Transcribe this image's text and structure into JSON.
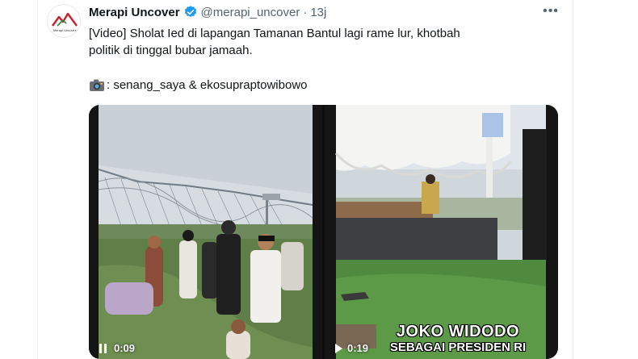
{
  "author": {
    "display_name": "Merapi Uncover",
    "handle": "@merapi_uncover",
    "separator": "·",
    "time": "13j",
    "avatar_caption": "Merapi Uncover"
  },
  "tweet": {
    "text": "[Video] Sholat Ied di lapangan Tamanan Bantul lagi rame lur,  khotbah politik di tinggal bubar jamaah.",
    "credit": ": senang_saya & ekosupraptowibowo",
    "more_label": "•••"
  },
  "media": {
    "videos": [
      {
        "timestamp": "0:09",
        "state": "paused"
      },
      {
        "timestamp": "0:19",
        "state": "playing",
        "caption_line1": "JOKO WIDODO",
        "caption_line2": "SEBAGAI PRESIDEN RI"
      }
    ]
  },
  "colors": {
    "text": "#0f1419",
    "secondary": "#536471",
    "verified": "#1d9bf0",
    "brand_red": "#c8202a"
  },
  "icons": {
    "verified": "verified-badge-icon",
    "more": "more-options-icon",
    "camera": "camera-emoji-icon",
    "pause": "pause-icon",
    "play": "play-icon"
  }
}
